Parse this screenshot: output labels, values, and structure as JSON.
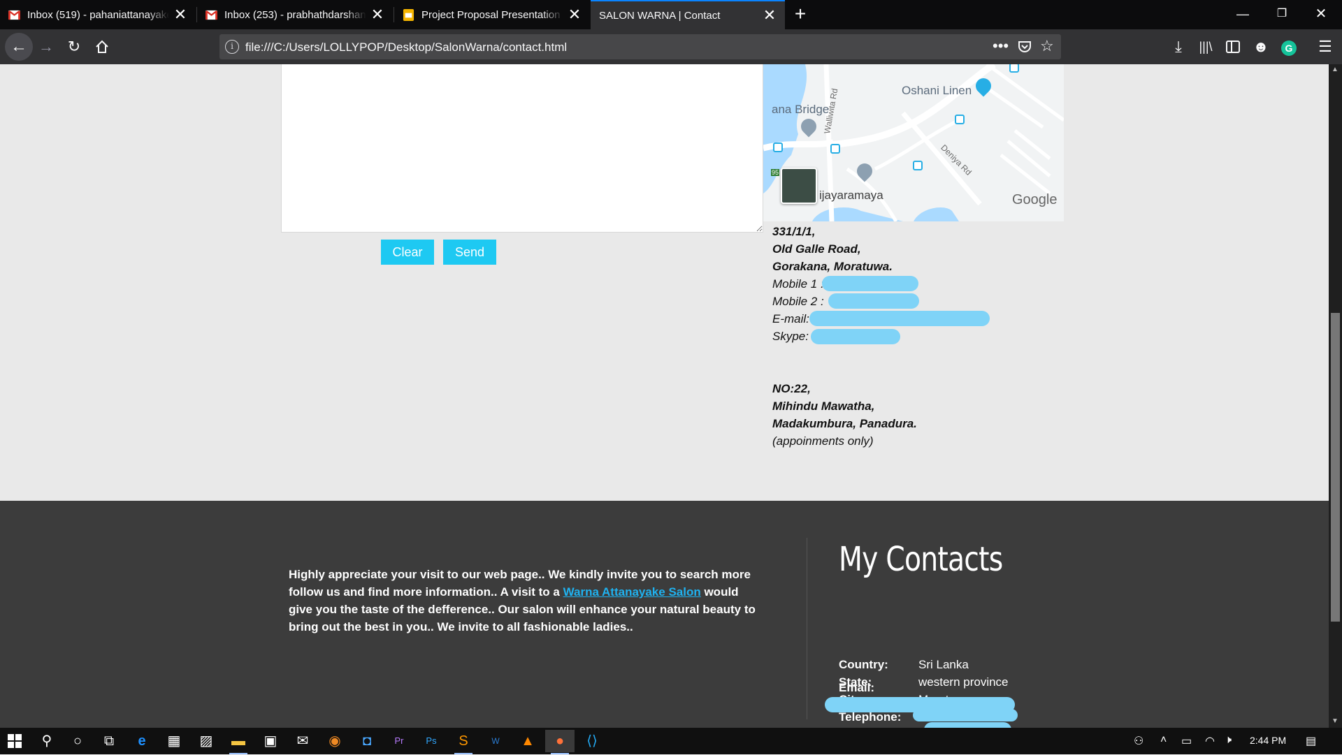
{
  "browser": {
    "tabs": [
      {
        "title": "Inbox (519) - pahaniattanayake",
        "icon": "gmail-icon",
        "active": false
      },
      {
        "title": "Inbox (253) - prabhathdarshana",
        "icon": "gmail-icon",
        "active": false
      },
      {
        "title": "Project Proposal Presentation -",
        "icon": "slides-icon",
        "active": false
      },
      {
        "title": "SALON WARNA | Contact",
        "icon": "",
        "active": true
      }
    ],
    "url": "file:///C:/Users/LOLLYPOP/Desktop/SalonWarna/contact.html"
  },
  "form": {
    "clear_label": "Clear",
    "send_label": "Send"
  },
  "map": {
    "labels": [
      "Oshani Linen",
      "ana Bridge",
      "ijayaramaya"
    ],
    "road_labels": [
      "Walliwita Rd",
      "Deniya Rd"
    ],
    "route_badge": "95",
    "logo": "Google"
  },
  "address1": {
    "line1": "331/1/1,",
    "line2": "Old Galle Road,",
    "line3": "Gorakana, Moratuwa.",
    "mobile1": "Mobile 1 :",
    "mobile2": "Mobile 2 :",
    "email": "E-mail:",
    "skype": "Skype:"
  },
  "address2": {
    "line1": "NO:22,",
    "line2": "Mihindu Mawatha,",
    "line3": "Madakumbura, Panadura.",
    "note": "(appoinments only)"
  },
  "footer": {
    "text_before": "Highly appreciate your visit to our web page.. We kindly invite you to search more follow us and find more information.. A visit to a ",
    "link": "Warna Attanayake Salon",
    "text_after": " would give you the taste of the defference.. Our salon will enhance your natural beauty to bring out the best in you.. We invite to all fashionable ladies..",
    "contacts_title": "My Contacts",
    "country_label": "Country:",
    "country": "Sri Lanka",
    "state_label": "State:",
    "state": "western province",
    "city_label": "City:",
    "city": "Moratuwa",
    "telephone_label": "Telephone:",
    "email_label": "Email:"
  },
  "taskbar": {
    "time": "2:44 PM"
  },
  "colors": {
    "button": "#1ec9f2",
    "footer_bg": "#3c3c3c",
    "link": "#1fb2f0",
    "redaction": "#7fd3f7"
  }
}
